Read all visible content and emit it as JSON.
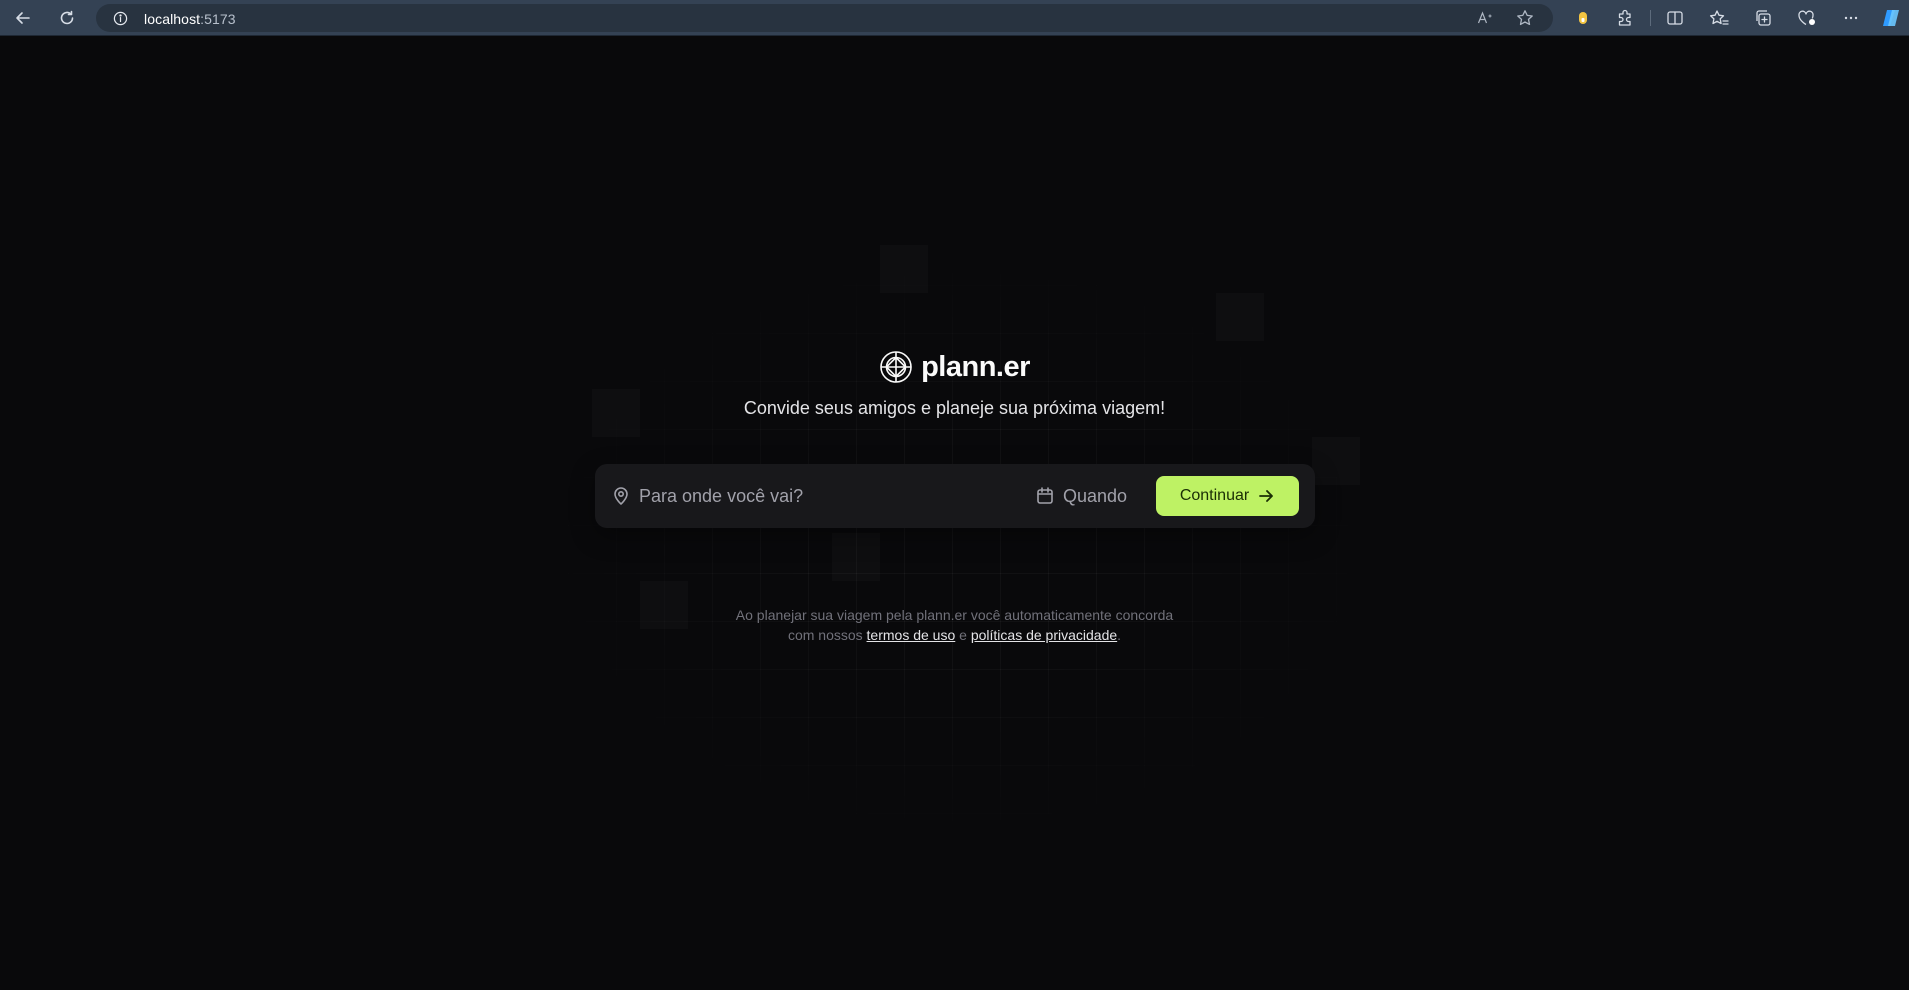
{
  "browser": {
    "url_host": "localhost",
    "url_port": ":5173",
    "icons": {
      "back": "back-arrow-icon",
      "reload": "reload-icon",
      "site_info": "info-icon",
      "read_aloud": "read-aloud-icon",
      "favorite": "star-icon",
      "extension": "extension-icon",
      "puzzle": "puzzle-icon",
      "split": "split-screen-icon",
      "favorites": "favorites-icon",
      "collections": "collections-icon",
      "performance": "heart-icon",
      "more": "more-icon",
      "copilot": "copilot-icon"
    }
  },
  "app": {
    "logo_text": "plann.er",
    "tagline": "Convide seus amigos e planeje sua próxima viagem!",
    "destination_placeholder": "Para onde você vai?",
    "when_label": "Quando",
    "continue_label": "Continuar",
    "legal_line1": "Ao planejar sua viagem pela plann.er você automaticamente concorda",
    "legal_prefix": "com nossos",
    "terms_link": "termos de uso",
    "legal_conjunction": "e",
    "privacy_link": "políticas de privacidade",
    "legal_suffix": "."
  },
  "colors": {
    "background": "#09090b",
    "accent": "#bef264",
    "card": "#18181b",
    "chrome": "#344254"
  }
}
